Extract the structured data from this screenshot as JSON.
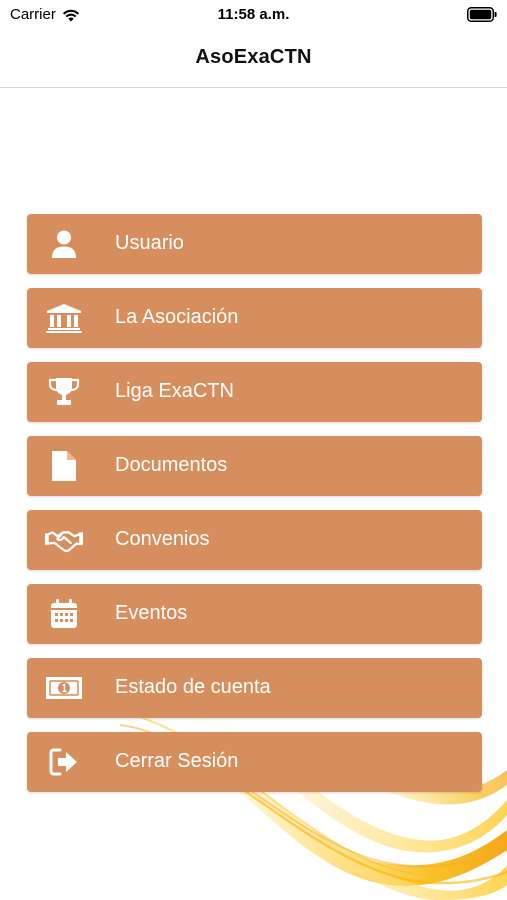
{
  "status_bar": {
    "carrier": "Carrier",
    "time": "11:58 a.m.",
    "wifi_icon": "wifi-icon",
    "battery_icon": "battery-icon"
  },
  "nav": {
    "title": "AsoExaCTN"
  },
  "menu": {
    "item_color": "#d78e5f",
    "items": [
      {
        "label": "Usuario",
        "icon": "user-icon"
      },
      {
        "label": "La Asociación",
        "icon": "institution-icon"
      },
      {
        "label": "Liga ExaCTN",
        "icon": "trophy-icon"
      },
      {
        "label": "Documentos",
        "icon": "document-icon"
      },
      {
        "label": "Convenios",
        "icon": "handshake-icon"
      },
      {
        "label": "Eventos",
        "icon": "calendar-icon"
      },
      {
        "label": "Estado de cuenta",
        "icon": "money-icon"
      },
      {
        "label": "Cerrar Sesión",
        "icon": "sign-out-icon"
      }
    ]
  }
}
